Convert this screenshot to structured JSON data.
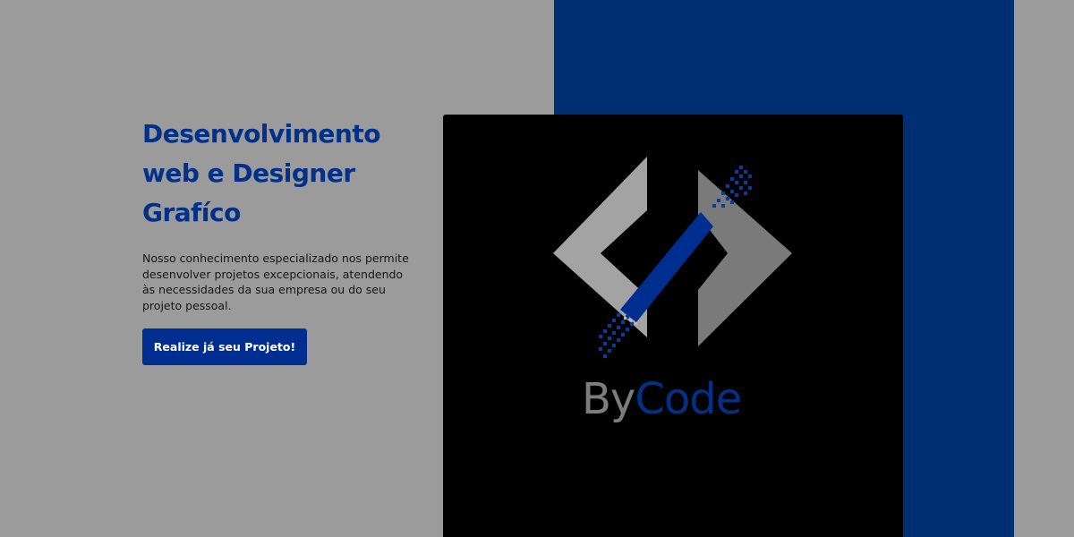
{
  "hero": {
    "title": "Desenvolvimento web e Designer Grafíco",
    "description": "Nosso conhecimento especializado nos permite desenvolver projetos excepcionais, atendendo às necessidades da sua empresa ou do seu projeto pessoal.",
    "cta_label": "Realize já seu Projeto!"
  },
  "logo": {
    "brand_part1": "By",
    "brand_part2": "Code",
    "icon": "code-brackets-icon"
  },
  "colors": {
    "background": "#9b9b9b",
    "brand_blue": "#003087",
    "panel_blue": "#002e73",
    "button_blue": "#002e90",
    "logo_gray_light": "#a3a3a3",
    "logo_gray_dark": "#7a7a7a",
    "card": "#000000"
  }
}
